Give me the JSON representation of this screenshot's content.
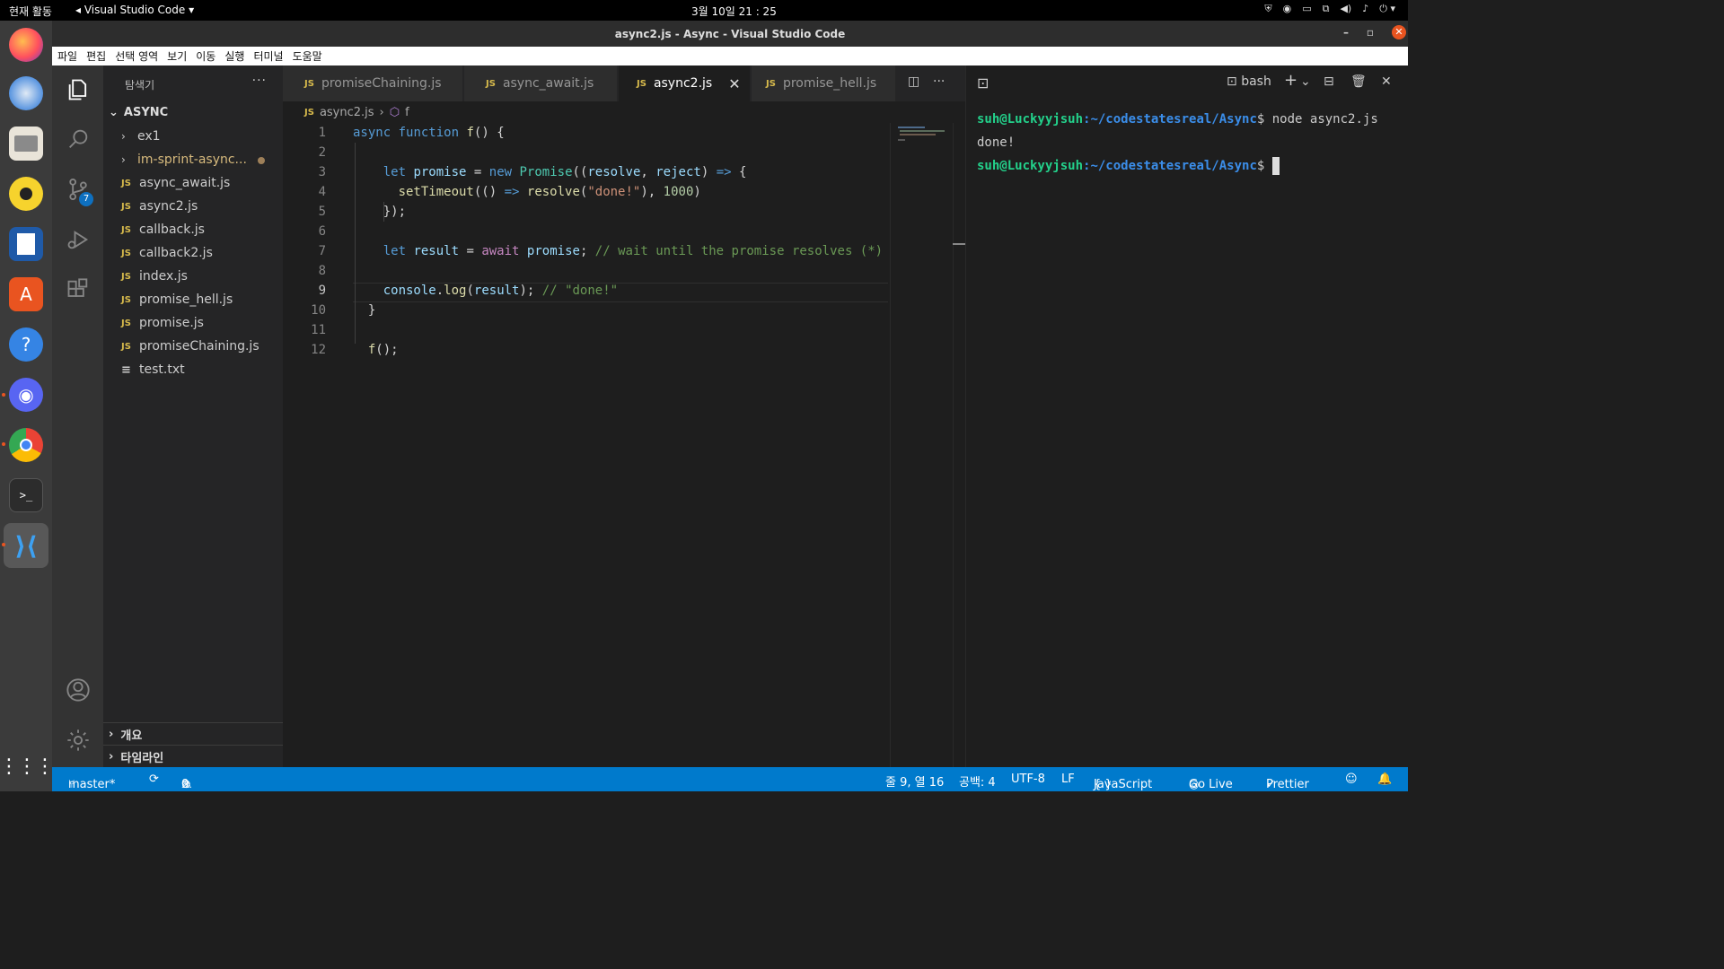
{
  "system": {
    "activities": "현재 활동",
    "app_name": "Visual Studio Code",
    "clock": "3월 10일  21 : 25"
  },
  "window": {
    "title": "async2.js - Async - Visual Studio Code"
  },
  "menu": [
    "파일",
    "편집",
    "선택 영역",
    "보기",
    "이동",
    "실행",
    "터미널",
    "도움말"
  ],
  "activity_bar": {
    "scm_badge": "7"
  },
  "explorer": {
    "header": "탐색기",
    "more": "···",
    "folder": "ASYNC",
    "items": [
      {
        "label": "ex1",
        "type": "folder"
      },
      {
        "label": "im-sprint-async...",
        "type": "folder"
      },
      {
        "label": "async_await.js",
        "type": "js"
      },
      {
        "label": "async2.js",
        "type": "js"
      },
      {
        "label": "callback.js",
        "type": "js"
      },
      {
        "label": "callback2.js",
        "type": "js"
      },
      {
        "label": "index.js",
        "type": "js"
      },
      {
        "label": "promise_hell.js",
        "type": "js"
      },
      {
        "label": "promise.js",
        "type": "js"
      },
      {
        "label": "promiseChaining.js",
        "type": "js"
      },
      {
        "label": "test.txt",
        "type": "txt"
      }
    ],
    "outline": "개요",
    "timeline": "타임라인"
  },
  "tabs": [
    {
      "label": "promiseChaining.js"
    },
    {
      "label": "async_await.js"
    },
    {
      "label": "async2.js"
    },
    {
      "label": "promise_hell.js"
    }
  ],
  "breadcrumb": {
    "file": "async2.js",
    "symbol": "f"
  },
  "code": {
    "line_numbers": [
      "1",
      "2",
      "3",
      "4",
      "5",
      "6",
      "7",
      "8",
      "9",
      "10",
      "11",
      "12"
    ]
  },
  "terminal": {
    "shell": "bash",
    "user_host": "suh@Luckyyjsuh",
    "path": ":~/codestatesreal/Async",
    "prompt_symbol": "$",
    "command": " node async2.js",
    "output": "done!"
  },
  "status": {
    "branch": "master*",
    "errors": "0",
    "warnings": "0",
    "position": "줄 9, 열 16",
    "indent": "공백: 4",
    "encoding": "UTF-8",
    "eol": "LF",
    "language": "JavaScript",
    "golive": "Go Live",
    "prettier": "Prettier"
  },
  "colors": {
    "accent": "#007acc",
    "dock": "#3b3b3b",
    "ubuntu_orange": "#e95420"
  }
}
